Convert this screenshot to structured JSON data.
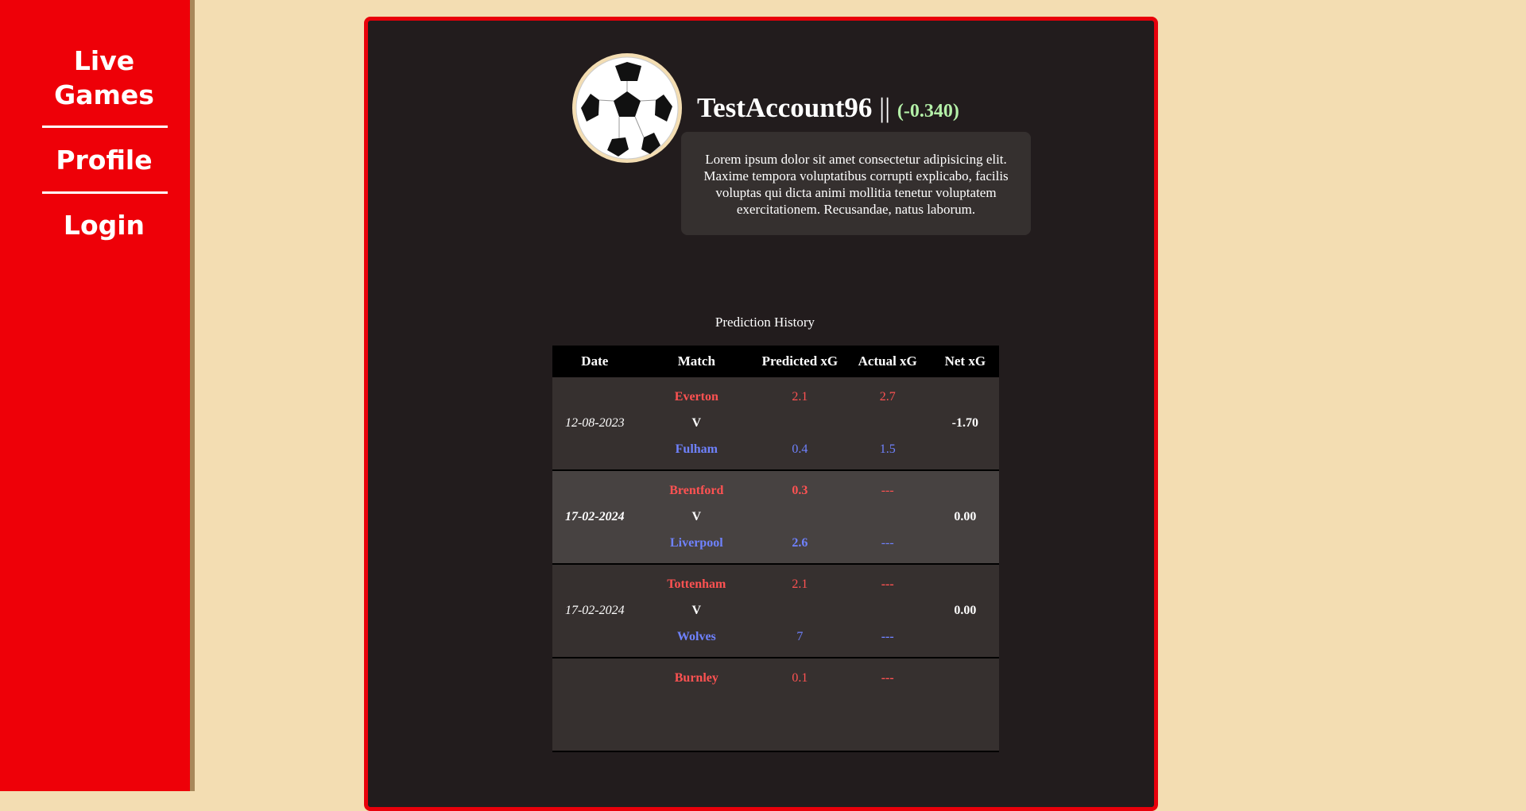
{
  "sidebar": {
    "items": [
      {
        "label": "Live\nGames"
      },
      {
        "label": "Profile"
      },
      {
        "label": "Login"
      }
    ]
  },
  "profile": {
    "username": "TestAccount96",
    "separator": "||",
    "score": "(-0.340)",
    "bio": "Lorem ipsum dolor sit amet consectetur adipisicing elit. Maxime tempora voluptatibus corrupti explicabo, facilis voluptas qui dicta animi mollitia tenetur voluptatem exercitationem. Recusandae, natus laborum."
  },
  "history": {
    "title": "Prediction History",
    "headers": [
      "Date",
      "Match",
      "Predicted xG",
      "Actual xG",
      "Net xG"
    ],
    "rows": [
      {
        "date": "12-08-2023",
        "home": "Everton",
        "vs": "V",
        "away": "Fulham",
        "pred_home": "2.1",
        "pred_away": "0.4",
        "act_home": "2.7",
        "act_away": "1.5",
        "net": "-1.70"
      },
      {
        "date": "17-02-2024",
        "home": "Brentford",
        "vs": "V",
        "away": "Liverpool",
        "pred_home": "0.3",
        "pred_away": "2.6",
        "act_home": "---",
        "act_away": "---",
        "net": "0.00"
      },
      {
        "date": "17-02-2024",
        "home": "Tottenham",
        "vs": "V",
        "away": "Wolves",
        "pred_home": "2.1",
        "pred_away": "7",
        "act_home": "---",
        "act_away": "---",
        "net": "0.00"
      },
      {
        "home": "Burnley",
        "pred_home": "0.1",
        "act_home": "---"
      }
    ]
  },
  "colors": {
    "sidebar": "#ee0008",
    "background": "#f3ddb2",
    "panel": "#221c1d",
    "home_team": "#ff5252",
    "away_team": "#6f82ff",
    "score": "#b4f0a8"
  },
  "icons": {
    "avatar": "soccer-ball-icon"
  }
}
